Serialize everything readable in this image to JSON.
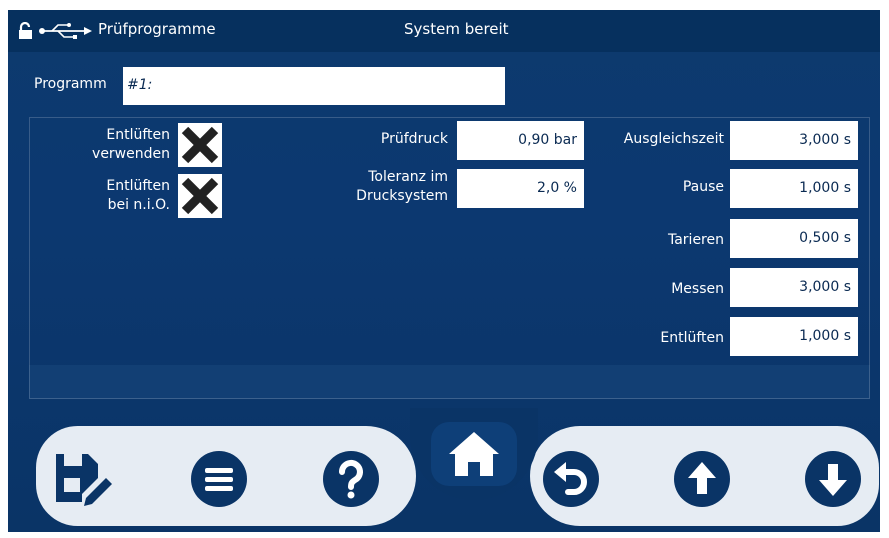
{
  "header": {
    "title": "Prüfprogramme",
    "status": "System bereit",
    "icons": [
      "unlock-icon",
      "usb-icon"
    ]
  },
  "program": {
    "label": "Programm",
    "value": "#1:"
  },
  "checkboxes": [
    {
      "label_line1": "Entlüften",
      "label_line2": "verwenden",
      "checked": true
    },
    {
      "label_line1": "Entlüften",
      "label_line2": "bei n.i.O.",
      "checked": true
    }
  ],
  "params_middle": [
    {
      "label": "Prüfdruck",
      "value": "0,90 bar"
    },
    {
      "label_line1": "Toleranz im",
      "label_line2": "Drucksystem",
      "value": "2,0 %"
    }
  ],
  "params_right": [
    {
      "label": "Ausgleichszeit",
      "value": "3,000 s"
    },
    {
      "label": "Pause",
      "value": "1,000 s"
    },
    {
      "label": "Tarieren",
      "value": "0,500 s"
    },
    {
      "label": "Messen",
      "value": "3,000 s"
    },
    {
      "label": "Entlüften",
      "value": "1,000 s"
    }
  ],
  "toolbar": {
    "buttons": [
      "save-edit-icon",
      "menu-icon",
      "help-icon",
      "home-icon",
      "undo-icon",
      "arrow-up-icon",
      "arrow-down-icon"
    ]
  },
  "colors": {
    "background": "#0c3870",
    "topbar": "#06305e",
    "toolbar": "#e6ecf3",
    "icon": "#0a3466"
  }
}
